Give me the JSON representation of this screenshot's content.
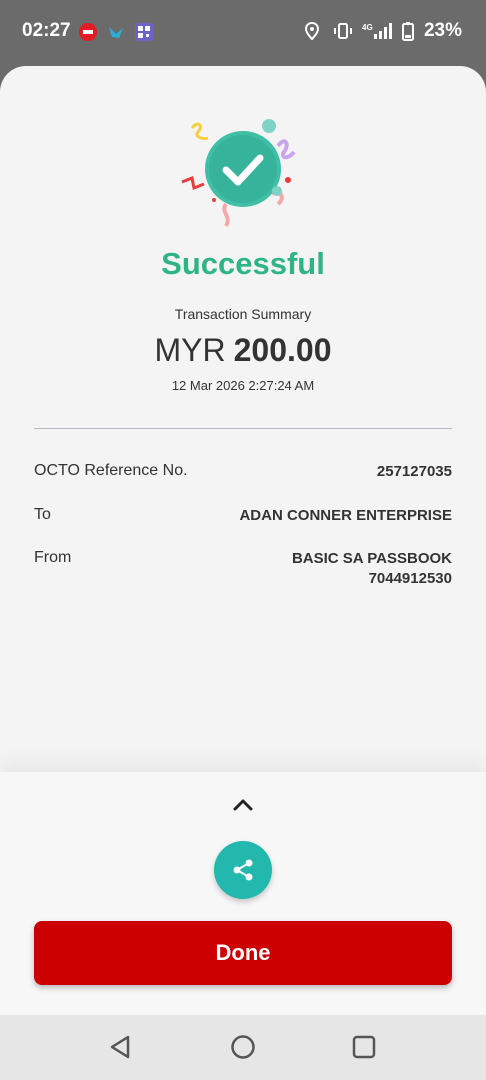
{
  "status_bar": {
    "time": "02:27",
    "battery": "23%",
    "network": "4G",
    "left_icons": [
      "app-notification-icon",
      "bird-app-icon",
      "qr-icon"
    ],
    "right_icons": [
      "location-icon",
      "vibrate-icon",
      "signal-icon",
      "battery-icon"
    ]
  },
  "result": {
    "title": "Successful",
    "summary_label": "Transaction Summary",
    "currency": "MYR",
    "amount": "200.00",
    "datetime": "12 Mar 2026 2:27:24 AM"
  },
  "details": {
    "reference_label": "OCTO Reference No.",
    "reference_value": "257127035",
    "to_label": "To",
    "to_value": "ADAN CONNER ENTERPRISE",
    "from_label": "From",
    "from_line1": "BASIC SA PASSBOOK",
    "from_line2": "7044912530"
  },
  "actions": {
    "done_label": "Done"
  },
  "colors": {
    "success": "#2fb585",
    "primary_button": "#cc0000",
    "share_button": "#22b8ad"
  }
}
